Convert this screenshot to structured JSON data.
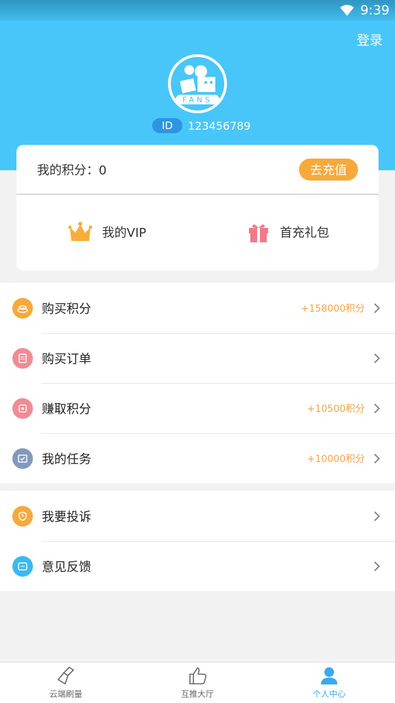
{
  "status_bar": {
    "time": "9:39"
  },
  "header": {
    "login_label": "登录",
    "id_badge": "ID",
    "id_value": "123456789"
  },
  "card": {
    "points_label": "我的积分：0",
    "recharge_label": "去充值",
    "vip_label": "我的VIP",
    "gift_label": "首充礼包"
  },
  "menu_group_1": [
    {
      "label": "购买积分",
      "extra": "+158000积分",
      "color": "#f7a93b",
      "icon": "coins-icon"
    },
    {
      "label": "购买订单",
      "extra": "",
      "color": "#f28b93",
      "icon": "clipboard-icon"
    },
    {
      "label": "赚取积分",
      "extra": "+10500积分",
      "color": "#f28b93",
      "icon": "coin-stack-icon"
    },
    {
      "label": "我的任务",
      "extra": "+10000积分",
      "color": "#8299bd",
      "icon": "task-icon"
    }
  ],
  "menu_group_2": [
    {
      "label": "我要投诉",
      "extra": "",
      "color": "#f7a93b",
      "icon": "shield-icon"
    },
    {
      "label": "意见反馈",
      "extra": "",
      "color": "#3ab9f0",
      "icon": "message-icon"
    }
  ],
  "tabbar": {
    "items": [
      {
        "label": "云端刷量",
        "icon": "broom-icon"
      },
      {
        "label": "互推大厅",
        "icon": "thumbs-up-icon"
      },
      {
        "label": "个人中心",
        "icon": "person-icon"
      }
    ],
    "active_color": "#3aaaf0"
  },
  "colors": {
    "header_bg": "#48c6fa",
    "accent_orange": "#f8a93a"
  }
}
